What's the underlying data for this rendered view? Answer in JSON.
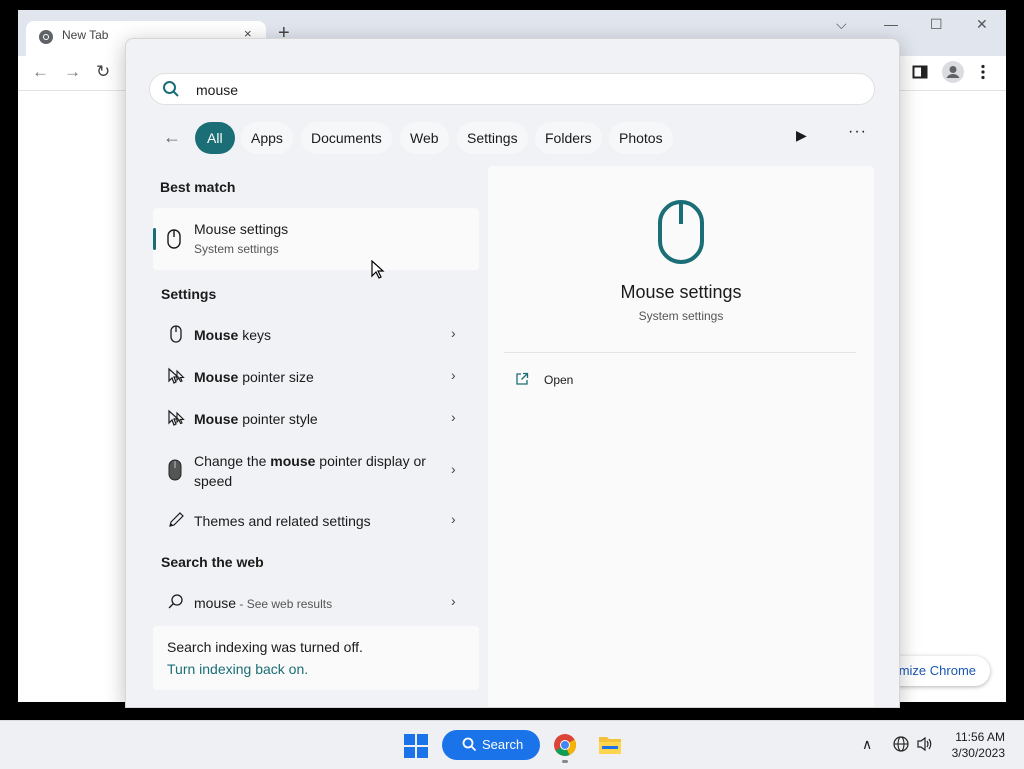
{
  "browser": {
    "tab_title": "New Tab",
    "tab_close": "×",
    "new_tab": "+",
    "customize_label": "mize Chrome",
    "nav_back": "←",
    "nav_forward": "→",
    "nav_reload": "↻",
    "win_dropdown": "⌵",
    "win_minimize": "—",
    "win_maximize": "☐",
    "win_close": "✕"
  },
  "search": {
    "query": "mouse",
    "filters": [
      "All",
      "Apps",
      "Documents",
      "Web",
      "Settings",
      "Folders",
      "Photos"
    ],
    "active_filter": "All",
    "back_icon": "←",
    "play_icon": "▶",
    "more_icon": "···"
  },
  "results": {
    "best_match_heading": "Best match",
    "best_match": {
      "title": "Mouse settings",
      "subtitle": "System settings",
      "icon": "mouse-icon"
    },
    "settings_heading": "Settings",
    "settings_items": [
      {
        "bold": "Mouse",
        "rest": " keys",
        "icon": "mouse-icon"
      },
      {
        "bold": "Mouse",
        "rest": " pointer size",
        "icon": "pointer-size-icon"
      },
      {
        "bold": "Mouse",
        "rest": " pointer style",
        "icon": "pointer-style-icon"
      },
      {
        "pre": "Change the ",
        "bold": "mouse",
        "rest": " pointer display or speed",
        "icon": "mouse-dark-icon"
      },
      {
        "rest": "Themes and related settings",
        "icon": "pen-icon"
      }
    ],
    "web_heading": "Search the web",
    "web_item": {
      "query": "mouse",
      "suffix": " - See web results"
    },
    "chevron": "›",
    "indexing": {
      "message": "Search indexing was turned off.",
      "link": "Turn indexing back on."
    }
  },
  "preview": {
    "title": "Mouse settings",
    "subtitle": "System settings",
    "actions": [
      {
        "label": "Open",
        "icon": "open-external-icon"
      }
    ]
  },
  "taskbar": {
    "search_label": "Search",
    "time": "11:56 AM",
    "date": "3/30/2023",
    "tray_chevron": "∧"
  },
  "colors": {
    "accent": "#1b6e76",
    "taskbar_search": "#1a73e8"
  }
}
